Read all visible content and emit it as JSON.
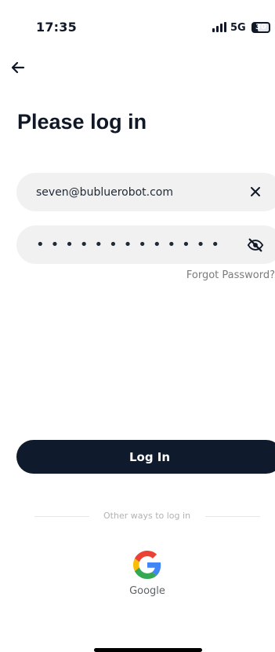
{
  "status_bar": {
    "time": "17:35",
    "network": "5G",
    "battery": "30",
    "signal_icon": "signal-bars"
  },
  "navigation": {
    "back_icon": "arrow-left"
  },
  "title": "Please log in",
  "form": {
    "email_value": "seven@bubluerobot.com",
    "password_value": "•••••••••••••",
    "clear_icon": "close",
    "visibility_icon": "eye-slash",
    "forgot_password": "Forgot Password?"
  },
  "login_button": "Log In",
  "other_ways": "Other ways to log in",
  "google": {
    "label": "Google",
    "icon": "google-logo"
  },
  "colors": {
    "primary_button": "#0f1b2d",
    "input_background": "#f1f1f1",
    "secondary_text": "#7b7b7b",
    "divider": "#e7e7e7"
  }
}
